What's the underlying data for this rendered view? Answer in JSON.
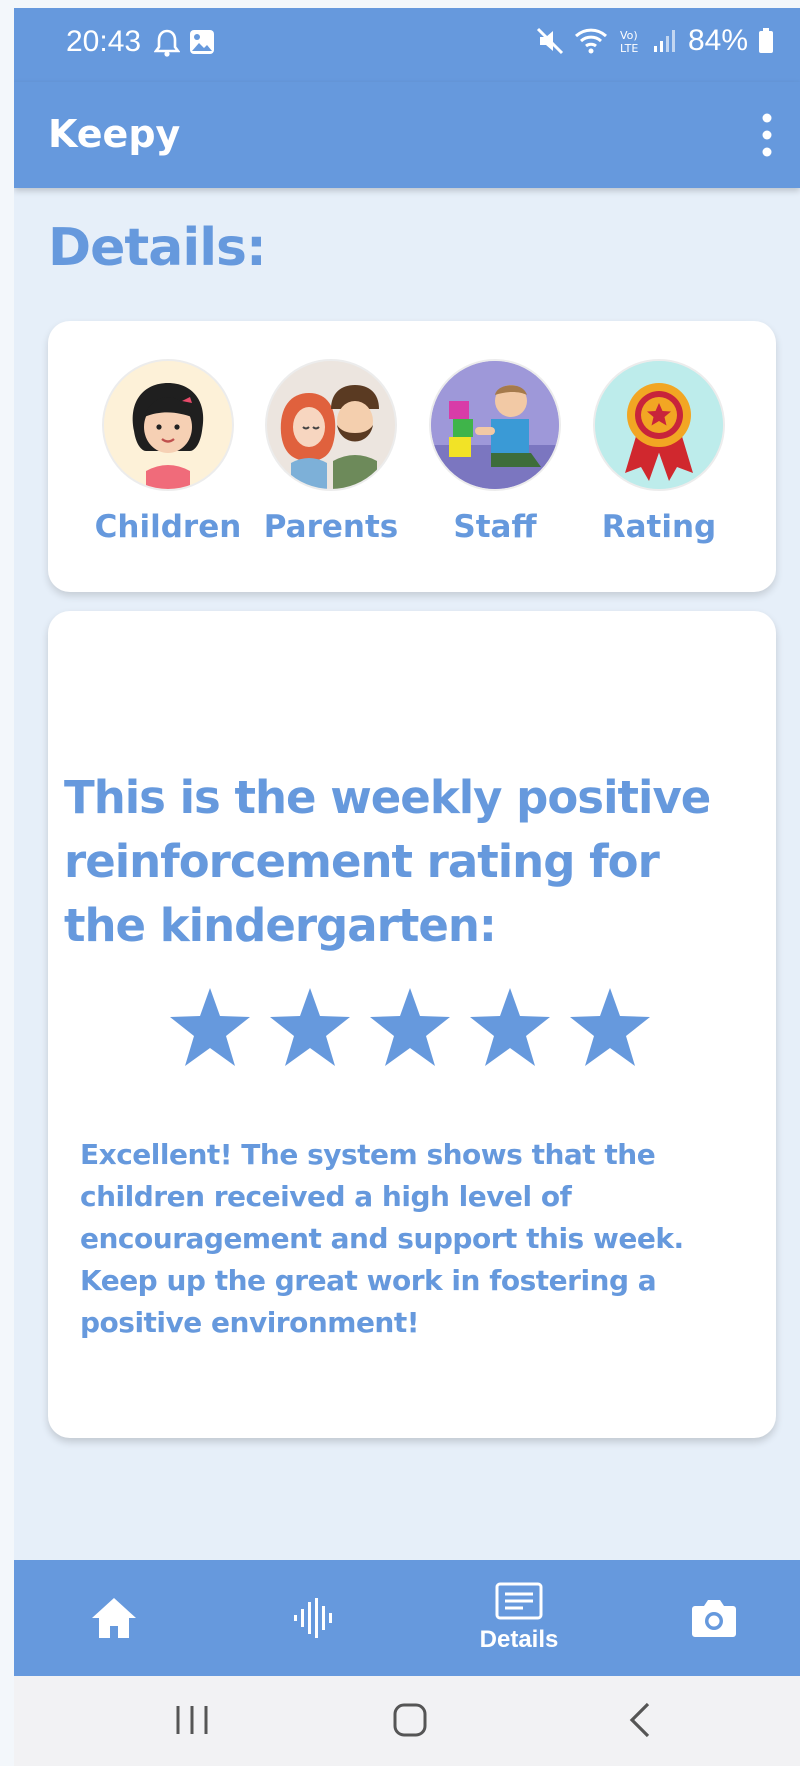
{
  "status": {
    "time": "20:43",
    "battery": "84%"
  },
  "app": {
    "title": "Keepy"
  },
  "page": {
    "heading": "Details:"
  },
  "categories": [
    {
      "label": "Children",
      "icon": "girl-avatar-icon"
    },
    {
      "label": "Parents",
      "icon": "parents-avatar-icon"
    },
    {
      "label": "Staff",
      "icon": "staff-avatar-icon"
    },
    {
      "label": "Rating",
      "icon": "rating-badge-icon"
    }
  ],
  "rating": {
    "title": "This is the weekly positive reinforcement rating for the kindergarten:",
    "stars": 5,
    "max_stars": 5,
    "description": "Excellent! The system shows that the children received a high level of encouragement and support this week. Keep up the great work in fostering a positive environment!"
  },
  "bottom_nav": {
    "items": [
      {
        "icon": "home-icon",
        "label": ""
      },
      {
        "icon": "audio-waveform-icon",
        "label": ""
      },
      {
        "icon": "details-icon",
        "label": "Details"
      },
      {
        "icon": "camera-icon",
        "label": ""
      }
    ]
  },
  "colors": {
    "primary": "#6699dd",
    "background": "#e6eff9",
    "card": "#ffffff"
  }
}
